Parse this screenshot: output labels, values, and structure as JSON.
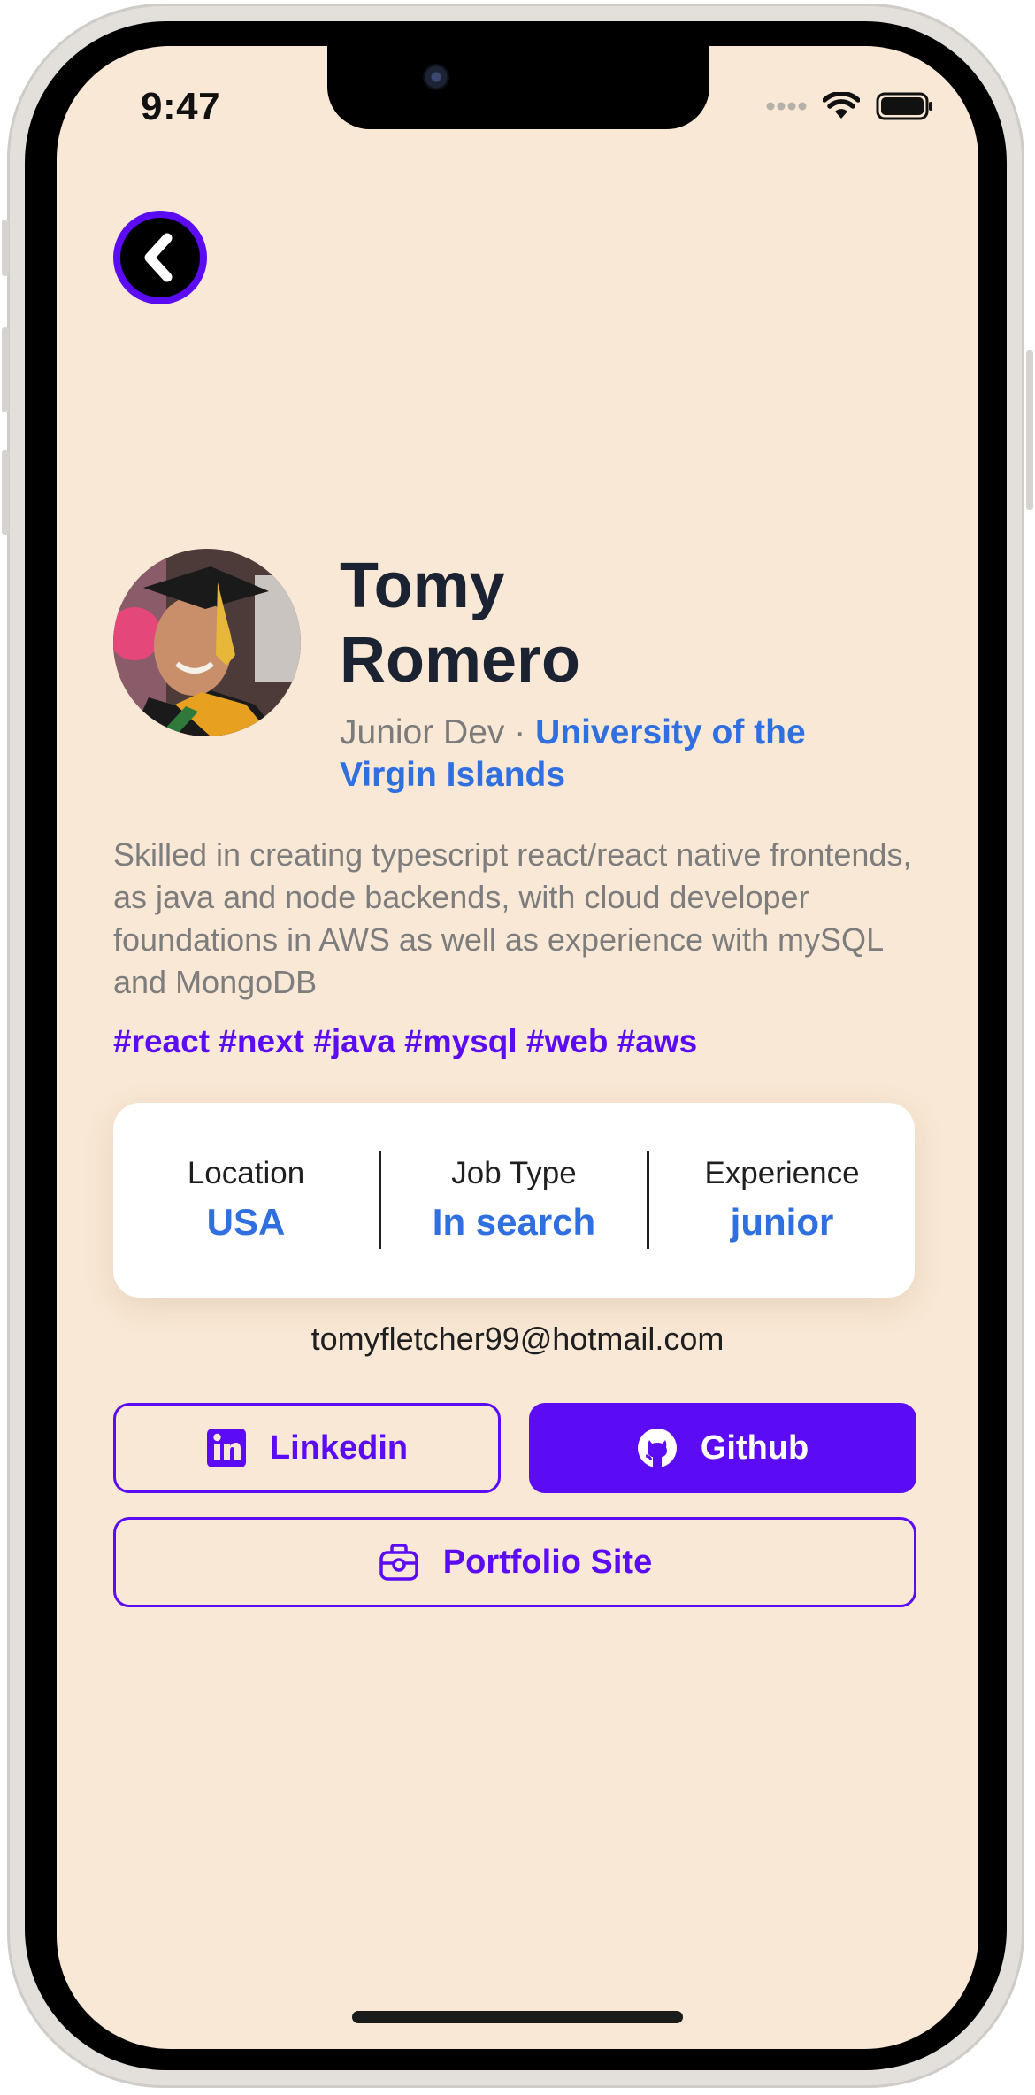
{
  "status_bar": {
    "time": "9:47"
  },
  "profile": {
    "first_name": "Tomy",
    "last_name": "Romero",
    "role": "Junior Dev",
    "separator": " · ",
    "university": "University of the Virgin Islands",
    "bio": "Skilled in creating typescript react/react native frontends, as java and node backends, with cloud developer foundations in AWS as well as experience with mySQL and MongoDB",
    "tags": "#react #next #java #mysql #web #aws"
  },
  "info": {
    "location_label": "Location",
    "location_value": "USA",
    "job_type_label": "Job Type",
    "job_type_value": "In search",
    "experience_label": "Experience",
    "experience_value": "junior"
  },
  "contact": {
    "email": "tomyfletcher99@hotmail.com"
  },
  "buttons": {
    "linkedin": "Linkedin",
    "github": "Github",
    "portfolio": "Portfolio Site"
  },
  "icons": {
    "back": "chevron-left-icon",
    "linkedin": "linkedin-icon",
    "github": "github-icon",
    "portfolio": "briefcase-icon"
  },
  "colors": {
    "background": "#f9e8d5",
    "accent": "#5b0cf5",
    "link_blue": "#2f6fe0",
    "heading": "#1b2231"
  }
}
